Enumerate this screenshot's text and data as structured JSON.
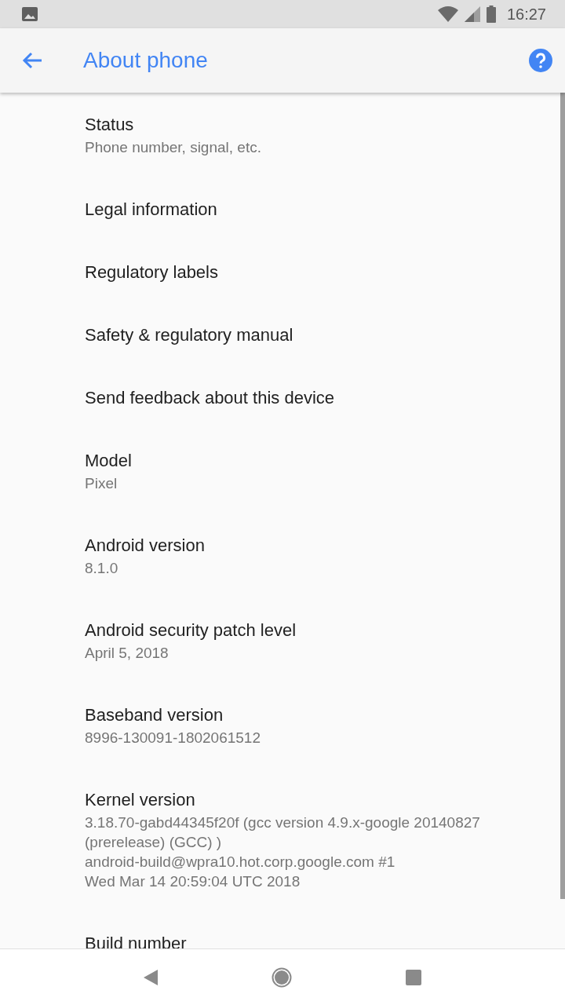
{
  "status_bar": {
    "time": "16:27"
  },
  "app_bar": {
    "title": "About phone"
  },
  "settings": [
    {
      "title": "Status",
      "summary": "Phone number, signal, etc."
    },
    {
      "title": "Legal information"
    },
    {
      "title": "Regulatory labels"
    },
    {
      "title": "Safety & regulatory manual"
    },
    {
      "title": "Send feedback about this device"
    },
    {
      "title": "Model",
      "summary": "Pixel"
    },
    {
      "title": "Android version",
      "summary": "8.1.0"
    },
    {
      "title": "Android security patch level",
      "summary": "April 5, 2018"
    },
    {
      "title": "Baseband version",
      "summary": "8996-130091-1802061512"
    },
    {
      "title": "Kernel version",
      "summary": "3.18.70-gabd44345f20f (gcc version 4.9.x-google 20140827\n(prerelease) (GCC) )\nandroid-build@wpra10.hot.corp.google.com #1\nWed Mar 14 20:59:04 UTC 2018"
    },
    {
      "title": "Build number"
    }
  ]
}
